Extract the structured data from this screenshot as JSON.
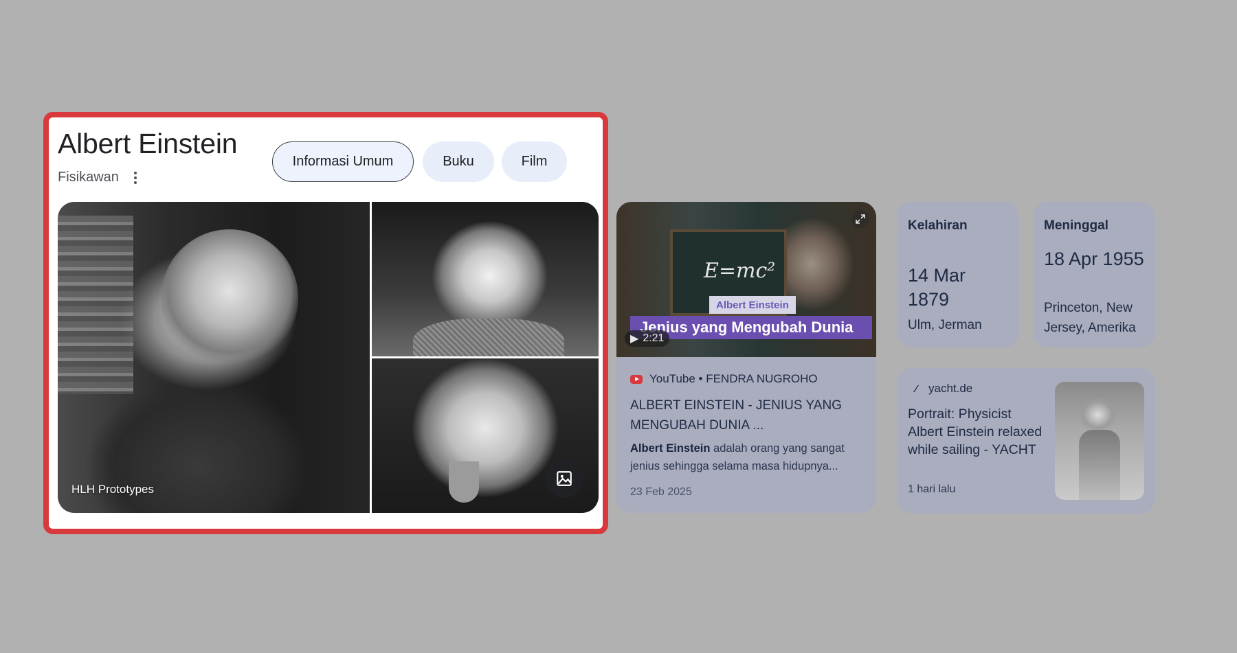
{
  "panel": {
    "title": "Albert Einstein",
    "subtitle": "Fisikawan",
    "tabs": [
      {
        "label": "Informasi Umum",
        "active": true
      },
      {
        "label": "Buku",
        "active": false
      },
      {
        "label": "Film",
        "active": false
      }
    ],
    "image_credit": "HLH Prototypes",
    "colors": {
      "highlight_border": "#d8393d",
      "chip_bg": "#e8edfa"
    }
  },
  "video": {
    "thumb_label": "Albert Einstein",
    "thumb_banner": "Jenius yang Mengubah Dunia",
    "thumb_formula": "E=mc²",
    "duration": "2:21",
    "source": "YouTube • FENDRA NUGROHO",
    "title": "ALBERT EINSTEIN - JENIUS YANG MENGUBAH DUNIA ...",
    "snippet_bold": "Albert Einstein",
    "snippet_rest": " adalah orang yang sangat jenius sehingga selama masa hidupnya...",
    "date": "23 Feb 2025"
  },
  "facts": {
    "birth": {
      "label": "Kelahiran",
      "date": "14 Mar 1879",
      "place": "Ulm, Jerman"
    },
    "death": {
      "label": "Meninggal",
      "date": "18 Apr 1955",
      "place": "Princeton, New Jersey, Amerika"
    }
  },
  "article": {
    "source": "yacht.de",
    "title": "Portrait: Physicist Albert Einstein relaxed while sailing - YACHT",
    "date": "1 hari lalu"
  }
}
